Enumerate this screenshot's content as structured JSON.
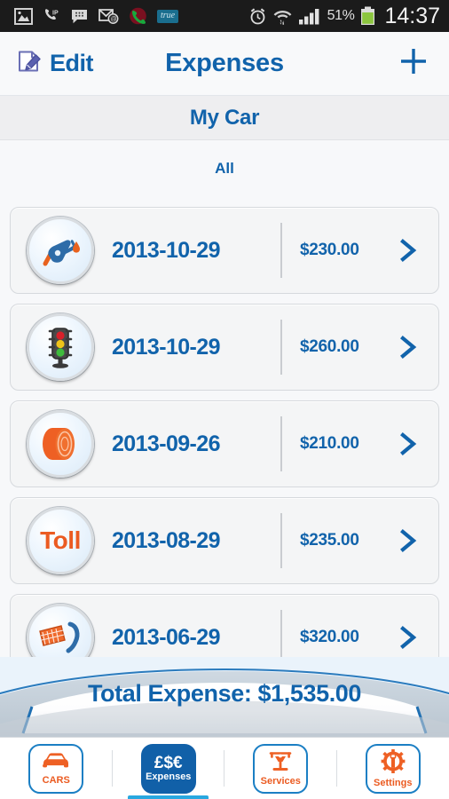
{
  "statusbar": {
    "left_icons": [
      "gallery-icon",
      "voip-phone-icon",
      "bbm-message-icon",
      "email-at-icon",
      "missed-call-icon",
      "true-app-icon"
    ],
    "true_label": "true",
    "alarm_icon": "alarm-clock-icon",
    "wifi_icon": "wifi-signal-icon",
    "signal_icon": "cell-signal-icon",
    "battery_percent": "51%",
    "battery_icon": "battery-icon",
    "clock": "14:37"
  },
  "navbar": {
    "edit_label": "Edit",
    "edit_icon": "note-pencil-icon",
    "title": "Expenses",
    "add_icon": "plus-icon"
  },
  "subheader": {
    "car_name": "My Car"
  },
  "filter": {
    "label": "All"
  },
  "list": {
    "rows": [
      {
        "icon": "fuel-pump-icon",
        "date": "2013-10-29",
        "amount": "$230.00",
        "chevron": "chevron-right-icon"
      },
      {
        "icon": "traffic-light-icon",
        "date": "2013-10-29",
        "amount": "$260.00",
        "chevron": "chevron-right-icon"
      },
      {
        "icon": "tire-icon",
        "date": "2013-09-26",
        "amount": "$210.00",
        "chevron": "chevron-right-icon"
      },
      {
        "icon": "toll-icon",
        "date": "2013-08-29",
        "amount": "$235.00",
        "chevron": "chevron-right-icon",
        "icon_text": "Toll"
      },
      {
        "icon": "ticket-icon",
        "date": "2013-06-29",
        "amount": "$320.00",
        "chevron": "chevron-right-icon"
      }
    ]
  },
  "banner": {
    "total_label": "Total Expense: $1,535.00"
  },
  "tabbar": {
    "tabs": [
      {
        "label": "CARS",
        "icon": "car-icon",
        "active": false
      },
      {
        "label": "Expenses",
        "icon": "currency-icon",
        "active": true,
        "symbols": "£$€"
      },
      {
        "label": "Services",
        "icon": "car-lift-icon",
        "active": false
      },
      {
        "label": "Settings",
        "icon": "gear-wrench-icon",
        "active": false
      }
    ]
  },
  "colors": {
    "primary_blue": "#1163ab",
    "accent_orange": "#eb5b21",
    "tab_active_blue": "#1160a8",
    "tab_border_blue": "#1b7fc4",
    "underline_blue": "#29a8e0",
    "page_bg": "#f7f8fa",
    "statusbar_bg": "#1b1b1b"
  }
}
